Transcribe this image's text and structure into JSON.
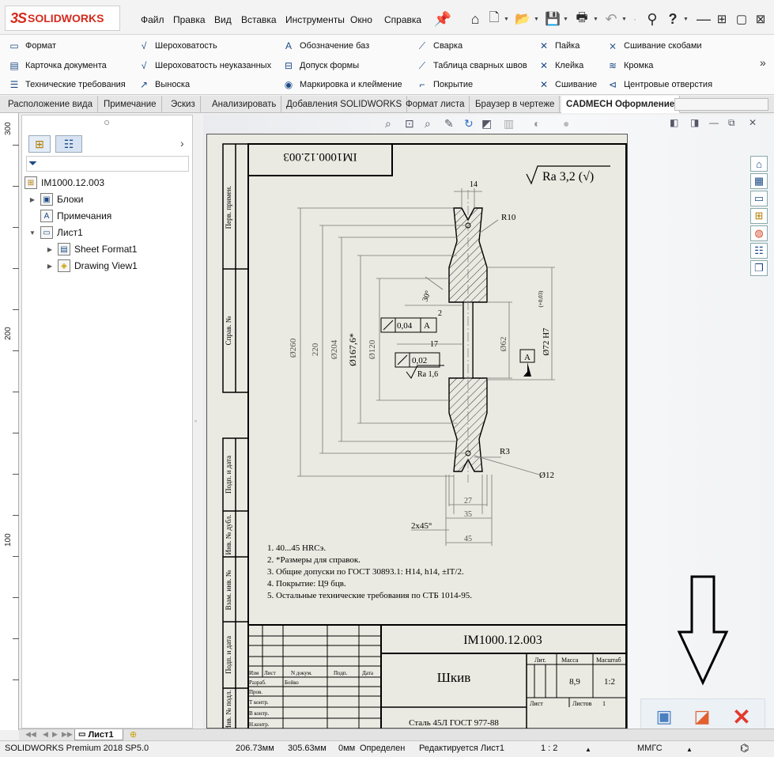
{
  "app": {
    "logo_ds": "3S",
    "logo_text": "SOLIDWORKS"
  },
  "menu": [
    "Файл",
    "Правка",
    "Вид",
    "Вставка",
    "Инструменты",
    "Окно",
    "Справка"
  ],
  "command_manager": {
    "col1": [
      "Формат",
      "Карточка документа",
      "Технические требования"
    ],
    "col2": [
      "Шероховатость",
      "Шероховатость неуказанных",
      "Выноска"
    ],
    "col3": [
      "Обозначение баз",
      "Допуск формы",
      "Маркировка и клеймение"
    ],
    "col4": [
      "Сварка",
      "Таблица сварных швов",
      "Покрытие"
    ],
    "col5": [
      "Пайка",
      "Клейка",
      "Сшивание"
    ],
    "col6": [
      "Сшивание скобами",
      "Кромка",
      "Центровые отверстия"
    ]
  },
  "tabs": [
    "Расположение вида",
    "Примечание",
    "Эскиз",
    "Анализировать",
    "Добавления SOLIDWORKS",
    "Формат листа",
    "Браузер в чертеже",
    "CADMECH Оформление"
  ],
  "ruler": [
    "300",
    "200",
    "100"
  ],
  "tree": {
    "root": "IM1000.12.003",
    "items": [
      "Блоки",
      "Примечания",
      "Лист1",
      "Sheet Format1",
      "Drawing View1"
    ]
  },
  "drawing": {
    "stamp_code": "IM1000.12.003",
    "roughness": "Ra 3,2 (√)",
    "dims": {
      "d14": "14",
      "r10": "R10",
      "a30": "30°",
      "d2": "2",
      "tol1": "0,04",
      "datum": "A",
      "d17": "17",
      "tol2": "0,02",
      "ra16": "Ra 1,6",
      "d260": "Ø260",
      "d220": "220",
      "d204": "Ø204",
      "d1676": "Ø167,6*",
      "d120": "Ø120",
      "d62": "Ø62",
      "d72": "Ø72 H7",
      "d72tol": "(+0,03)",
      "r3": "R3",
      "d12": "Ø12",
      "d27": "27",
      "d35": "35",
      "d45": "45",
      "chamfer": "2x45°"
    },
    "side_labels": [
      "Перв. примен.",
      "Справ. №",
      "Подп. и дата",
      "Инв. № дубл.",
      "Взам. инв. №",
      "Подп. и дата",
      "Инв. № подл."
    ],
    "notes": [
      "1. 40...45 HRCэ.",
      "2. *Размеры для справок.",
      "3. Общие допуски по ГОСТ 30893.1: H14, h14, ±IT/2.",
      "4. Покрытие: Ц9 бцв.",
      "5. Остальные технические требования по СТБ 1014-95."
    ],
    "title_block": {
      "code": "IM1000.12.003",
      "name": "Шкив",
      "material": "Сталь 45Л ГОСТ 977-88",
      "lit": "Лит.",
      "mass_label": "Масса",
      "scale_label": "Масштаб",
      "mass": "8,9",
      "scale": "1:2",
      "sheet_label": "Лист",
      "sheets_label": "Листов",
      "sheets": "1",
      "headers": [
        "Изм",
        "Лист",
        "N докум.",
        "Подп.",
        "Дата"
      ],
      "rows": [
        "Разраб.",
        "Пров.",
        "Т контр.",
        "В контр.",
        "Н.контр."
      ],
      "developer": "Бойко"
    }
  },
  "bottom_tab": "Лист1",
  "status": {
    "product": "SOLIDWORKS Premium 2018 SP5.0",
    "x": "206.73мм",
    "y": "305.63мм",
    "z": "0мм",
    "state": "Определен",
    "editing": "Редактируется Лист1",
    "scale": "1 : 2",
    "units": "ММГС"
  }
}
